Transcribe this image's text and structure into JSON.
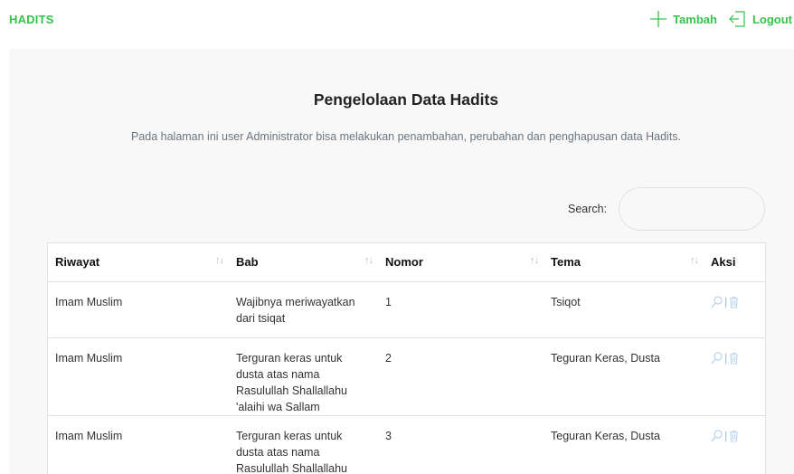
{
  "brand": "HADITS",
  "nav": {
    "add_label": "Tambah",
    "logout_label": "Logout"
  },
  "page": {
    "title": "Pengelolaan Data Hadits",
    "subtitle": "Pada halaman ini user Administrator bisa melakukan penambahan, perubahan dan penghapusan data Hadits."
  },
  "search": {
    "label": "Search:",
    "value": "",
    "placeholder": ""
  },
  "table": {
    "headers": [
      "Riwayat",
      "Bab",
      "Nomor",
      "Tema",
      "Aksi"
    ],
    "sort_glyph": "↑↓",
    "rows": [
      {
        "riwayat": "Imam Muslim",
        "bab": "Wajibnya meriwayatkan dari tsiqat",
        "nomor": "1",
        "tema": "Tsiqot"
      },
      {
        "riwayat": "Imam Muslim",
        "bab": "Terguran keras untuk dusta atas nama Rasulullah Shallallahu 'alaihi wa Sallam",
        "nomor": "2",
        "tema": "Teguran Keras, Dusta"
      },
      {
        "riwayat": "Imam Muslim",
        "bab": "Terguran keras untuk dusta atas nama Rasulullah Shallallahu 'alaihi wa Sallam",
        "nomor": "3",
        "tema": "Teguran Keras, Dusta"
      }
    ],
    "action_separator": "|"
  },
  "icons": {
    "add": "plus-icon",
    "logout": "logout-icon",
    "view": "magnifier-icon",
    "delete": "trash-icon"
  },
  "colors": {
    "accent": "#36c24c",
    "panel_bg": "#f8f8f8",
    "action_icon": "#b9d4ee"
  }
}
